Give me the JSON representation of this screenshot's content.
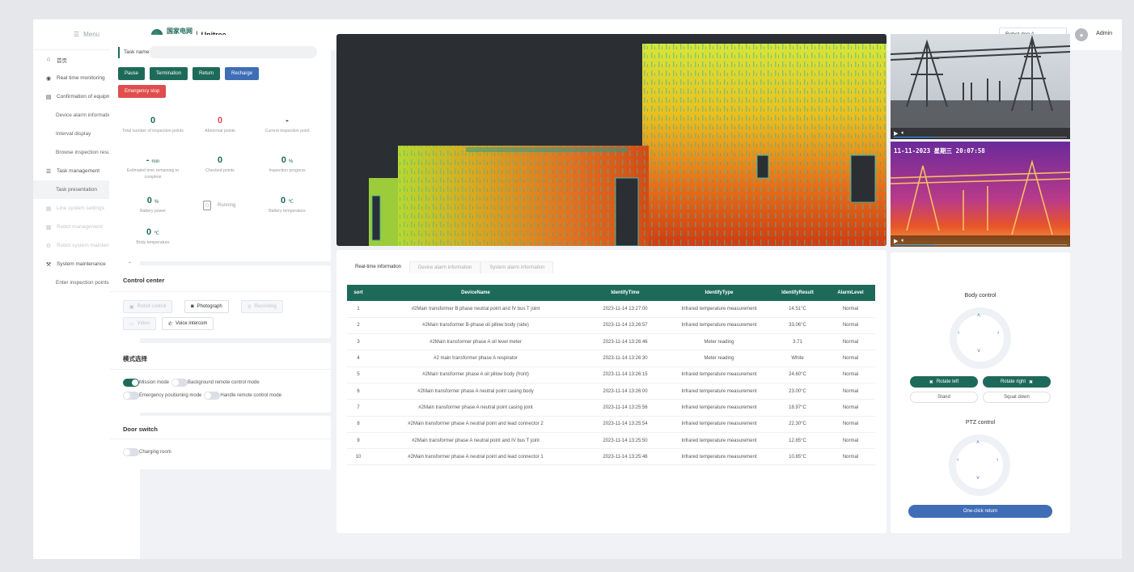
{
  "sidebar": {
    "menu_label": "Menu",
    "items": [
      {
        "label": "首页",
        "icon": "home-icon",
        "type": "main"
      },
      {
        "label": "Real time monitoring",
        "icon": "eye-icon",
        "type": "main",
        "arrow": "⌄"
      },
      {
        "label": "Confirmation of equipm...",
        "icon": "doc-icon",
        "type": "main",
        "arrow": "⌃"
      },
      {
        "label": "Device alarm information c...",
        "type": "sub"
      },
      {
        "label": "Interval display",
        "type": "sub"
      },
      {
        "label": "Browse inspection results",
        "type": "sub"
      },
      {
        "label": "Task management",
        "icon": "list-icon",
        "type": "main",
        "arrow": "⌃"
      },
      {
        "label": "Task presentation",
        "type": "sub",
        "active": true
      },
      {
        "label": "Line system settings",
        "icon": "grid-icon",
        "type": "disabled"
      },
      {
        "label": "Robot management",
        "icon": "robot-icon",
        "type": "disabled"
      },
      {
        "label": "Robot system maintenance",
        "icon": "gear-icon",
        "type": "disabled"
      },
      {
        "label": "System maintenance",
        "icon": "wrench-icon",
        "type": "main",
        "arrow": "⌃"
      },
      {
        "label": "Enter inspection points",
        "type": "sub"
      }
    ]
  },
  "header": {
    "logo_cn": "国家电网",
    "logo_en": "State Grid",
    "brand": "Unitree",
    "robot_select": "Robot dog A",
    "user": "Admin"
  },
  "task": {
    "name_label": "Task name",
    "name_value": "",
    "buttons": {
      "pause": "Pause",
      "termination": "Termination",
      "return": "Return",
      "recharge": "Recharge",
      "emergency": "Emergency stop"
    },
    "stats": {
      "total": {
        "value": "0",
        "label": "Total number of inspection points"
      },
      "abnormal": {
        "value": "0",
        "label": "Abnormal points"
      },
      "current": {
        "value": "-",
        "label": "Current inspection point"
      },
      "remaining": {
        "value": "-",
        "unit": "min",
        "label": "Estimated time remaining to complete"
      },
      "checked": {
        "value": "0",
        "label": "Checked points"
      },
      "progress": {
        "value": "0",
        "unit": "%",
        "label": "Inspection progress"
      },
      "battery_power": {
        "value": "0",
        "unit": "%",
        "label": "Battery power"
      },
      "running": {
        "label": "Running"
      },
      "battery_temp": {
        "value": "0",
        "unit": "℃",
        "label": "Battery temperature"
      },
      "body_temp": {
        "value": "0",
        "unit": "℃",
        "label": "Body temperature"
      }
    }
  },
  "control_center": {
    "title": "Control center",
    "robot_control": "Robot control",
    "photograph": "Photograph",
    "recording": "Recording",
    "video": "Video",
    "voice_intercom": "Voice intercom"
  },
  "mode": {
    "title": "模式选择",
    "mission": "Mission mode",
    "background": "Background remote control mode",
    "emergency": "Emergency positioning mode",
    "handle": "Handle remote control mode"
  },
  "door": {
    "title": "Door switch",
    "charging": "Charging room"
  },
  "camera": {
    "thermal_timestamp": "11-11-2023 星期三 20:07:58"
  },
  "info": {
    "tabs": [
      "Real-time information",
      "Device alarm information",
      "System alarm information"
    ],
    "columns": [
      "sort",
      "DeviceName",
      "IdentifyTime",
      "IdentifyType",
      "IdentifyResult",
      "AlarmLevel"
    ],
    "rows": [
      [
        "1",
        "#2Main transformer B phase neutral point and IV bus T joint",
        "2023-11-14 13:27:00",
        "Infrared temperature measurement",
        "14.51°C",
        "Normal"
      ],
      [
        "2",
        "#2Main transformer B-phase oil pillow body (side)",
        "2023-11-14 13:26:57",
        "Infrared temperature measurement",
        "33.06°C",
        "Normal"
      ],
      [
        "3",
        "#2Main transformer phase A oil level meter",
        "2023-11-14 13:26:46",
        "Meter reading",
        "3.71",
        "Normal"
      ],
      [
        "4",
        "#2 main transformer phase A respirator",
        "2023-11-14 13:26:30",
        "Meter reading",
        "White",
        "Normal"
      ],
      [
        "5",
        "#2Main transformer phase A oil pillow body (front)",
        "2023-11-14 13:26:15",
        "Infrared temperature measurement",
        "24.60°C",
        "Normal"
      ],
      [
        "6",
        "#2Main transformer phase A neutral point casing body",
        "2023-11-14 13:26:00",
        "Infrared temperature measurement",
        "23.00°C",
        "Normal"
      ],
      [
        "7",
        "#2Main transformer phase A neutral point casing joint",
        "2023-11-14 13:25:56",
        "Infrared temperature measurement",
        "18.97°C",
        "Normal"
      ],
      [
        "8",
        "#2Main transformer phase A neutral point and lead connector 2",
        "2023-11-14 13:25:54",
        "Infrared temperature measurement",
        "22.30°C",
        "Normal"
      ],
      [
        "9",
        "#2Main transformer phase A neutral point and IV bus T joint",
        "2023-11-14 13:25:50",
        "Infrared temperature measurement",
        "12.85°C",
        "Normal"
      ],
      [
        "10",
        "#2Main transformer phase A neutral point and lead connector 1",
        "2023-11-14 13:25:46",
        "Infrared temperature measurement",
        "10.85°C",
        "Normal"
      ]
    ]
  },
  "body_control": {
    "title": "Body control",
    "rotate_left": "Rotate left",
    "rotate_right": "Rotate right",
    "stand": "Stand",
    "squat": "Squat down"
  },
  "ptz": {
    "title": "PTZ control",
    "return": "One-click return"
  }
}
